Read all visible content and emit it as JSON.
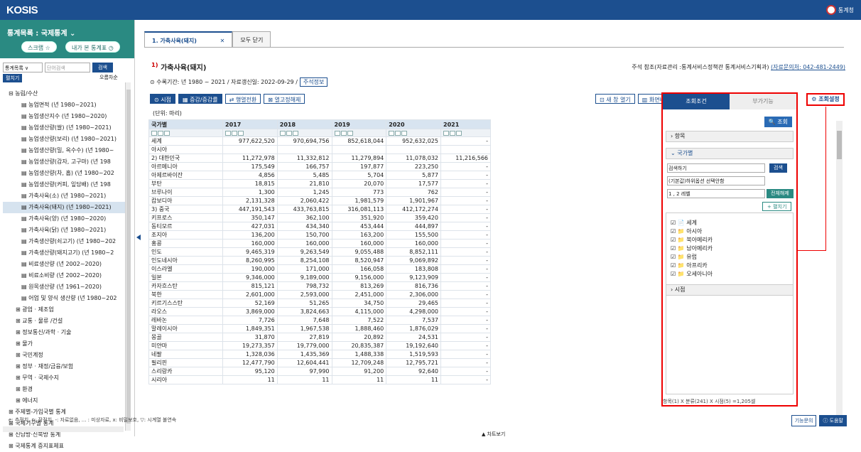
{
  "app": {
    "logo": "KOSIS",
    "agency": "통계청"
  },
  "sidebar": {
    "title": "통계목록 : 국제통계 ⌄",
    "btn1": "스크랩 ☆",
    "btn2": "내가 본 통계표 ◷",
    "select": "통계목록 ∨",
    "placeholder": "단어검색",
    "search": "검색",
    "menu": "펼치기",
    "sort": "오름차순",
    "tree": [
      {
        "t": "⊟ 농림/수산",
        "l": "lvl0"
      },
      {
        "t": "▤ 농업면적 (년 1980~2021)",
        "l": "lvl2"
      },
      {
        "t": "▤ 농업생산지수 (년 1980~2020)",
        "l": "lvl2"
      },
      {
        "t": "▤ 농업생산량(쌀) (년 1980~2021)",
        "l": "lvl2"
      },
      {
        "t": "▤ 농업생산량(보리) (년 1980~2021)",
        "l": "lvl2"
      },
      {
        "t": "▤ 농업생산량(밀, 옥수수) (년 1980~",
        "l": "lvl2"
      },
      {
        "t": "▤ 농업생산량(감자, 고구마) (년 198",
        "l": "lvl2"
      },
      {
        "t": "▤ 농업생산량(차, 홉) (년 1980~202",
        "l": "lvl2"
      },
      {
        "t": "▤ 농업생산량(커피, 잎담배) (년 198",
        "l": "lvl2"
      },
      {
        "t": "▤ 가축사육(소) (년 1980~2021)",
        "l": "lvl2"
      },
      {
        "t": "▤ 가축사육(돼지) (년 1980~2021)",
        "l": "lvl2 sel-item"
      },
      {
        "t": "▤ 가축사육(양) (년 1980~2020)",
        "l": "lvl2"
      },
      {
        "t": "▤ 가축사육(닭) (년 1980~2021)",
        "l": "lvl2"
      },
      {
        "t": "▤ 가축생산량(쇠고기) (년 1980~202",
        "l": "lvl2"
      },
      {
        "t": "▤ 가축생산량(돼지고기) (년 1980~2",
        "l": "lvl2"
      },
      {
        "t": "▤ 비료생산량 (년 2002~2020)",
        "l": "lvl2"
      },
      {
        "t": "▤ 비료소비량 (년 2002~2020)",
        "l": "lvl2"
      },
      {
        "t": "▤ 원목생산량 (년 1961~2020)",
        "l": "lvl2"
      },
      {
        "t": "▤ 어업 및 양식 생산량 (년 1980~202",
        "l": "lvl2"
      },
      {
        "t": "⊞ 광업 · 제조업",
        "l": "lvl1"
      },
      {
        "t": "⊞ 교통 · 물류 /건설",
        "l": "lvl1"
      },
      {
        "t": "⊞ 정보통신/과학 · 기술",
        "l": "lvl1"
      },
      {
        "t": "⊞ 물가",
        "l": "lvl1"
      },
      {
        "t": "⊞ 국민계정",
        "l": "lvl1"
      },
      {
        "t": "⊞ 정부 · 재정/금융/보험",
        "l": "lvl1"
      },
      {
        "t": "⊞ 무역 · 국제수지",
        "l": "lvl1"
      },
      {
        "t": "⊞ 환경",
        "l": "lvl1"
      },
      {
        "t": "⊞ 에너지",
        "l": "lvl1"
      },
      {
        "t": "⊞ 주제별-가입국별 통계",
        "l": "lvl0"
      },
      {
        "t": "⊞ 국제기구별 통계",
        "l": "lvl0"
      },
      {
        "t": "⊞ 신남방·신북방 통계",
        "l": "lvl0"
      },
      {
        "t": "⊞ 국제통계 증지표체표",
        "l": "lvl0"
      }
    ]
  },
  "tabs": {
    "active": "1. 가축사육(돼지)",
    "close": "✕",
    "closeall": "모두 닫기"
  },
  "table": {
    "title": "가축사육(돼지)",
    "sup": "1)",
    "notice": "주석 참조(자료관리 :통계서비스정책관 통계서비스기획과)",
    "contact": "(자료문의처: 042-481-2449)",
    "info": "⊙ 수록기간: 년 1980 ~ 2021 / 자료갱신일: 2022-09-29 /",
    "infobtn": "주석정보",
    "tb": [
      "⊙ 시점",
      "▦ 증감/증감률",
      "⇄ 행열전환",
      "⊠ 열고정해제"
    ],
    "tbr": [
      "⊡ 새 창 열기",
      "▥ 화면비"
    ],
    "unit": "(단위: 마리)",
    "headers": [
      "국가별",
      "2017",
      "2018",
      "2019",
      "2020",
      "2021"
    ],
    "rows": [
      [
        "세계",
        "977,622,520",
        "970,694,756",
        "852,618,044",
        "952,632,025",
        "-"
      ],
      [
        "아시아",
        "",
        "",
        "",
        "",
        ""
      ],
      [
        "2) 대한민국",
        "11,272,978",
        "11,332,812",
        "11,279,894",
        "11,078,032",
        "11,216,566"
      ],
      [
        "아르메니아",
        "175,549",
        "166,757",
        "197,877",
        "223,250",
        "-"
      ],
      [
        "아제르바이잔",
        "4,856",
        "5,485",
        "5,704",
        "5,877",
        "-"
      ],
      [
        "부탄",
        "18,815",
        "21,810",
        "20,070",
        "17,577",
        "-"
      ],
      [
        "브루나이",
        "1,300",
        "1,245",
        "773",
        "762",
        "-"
      ],
      [
        "캄보디아",
        "2,131,328",
        "2,060,422",
        "1,981,579",
        "1,901,967",
        "-"
      ],
      [
        "3) 중국",
        "447,191,543",
        "433,763,815",
        "316,081,113",
        "412,172,274",
        "-"
      ],
      [
        "키프로스",
        "350,147",
        "362,100",
        "351,920",
        "359,420",
        "-"
      ],
      [
        "동티모르",
        "427,031",
        "434,340",
        "453,444",
        "444,897",
        "-"
      ],
      [
        "조지아",
        "136,200",
        "150,700",
        "163,200",
        "155,500",
        "-"
      ],
      [
        "홍콩",
        "160,000",
        "160,000",
        "160,000",
        "160,000",
        "-"
      ],
      [
        "인도",
        "9,465,319",
        "9,263,549",
        "9,055,488",
        "8,852,111",
        "-"
      ],
      [
        "인도네시아",
        "8,260,995",
        "8,254,108",
        "8,520,947",
        "9,069,892",
        "-"
      ],
      [
        "이스라엘",
        "190,000",
        "171,000",
        "166,058",
        "183,808",
        "-"
      ],
      [
        "일본",
        "9,346,000",
        "9,189,000",
        "9,156,000",
        "9,123,909",
        "-"
      ],
      [
        "카자흐스탄",
        "815,121",
        "798,732",
        "813,269",
        "816,736",
        "-"
      ],
      [
        "북한",
        "2,601,000",
        "2,593,000",
        "2,451,000",
        "2,306,000",
        "-"
      ],
      [
        "키르기스스탄",
        "52,169",
        "51,265",
        "34,750",
        "29,465",
        "-"
      ],
      [
        "라오스",
        "3,869,000",
        "3,824,663",
        "4,115,000",
        "4,298,000",
        "-"
      ],
      [
        "레바논",
        "7,726",
        "7,648",
        "7,522",
        "7,537",
        "-"
      ],
      [
        "말레이시아",
        "1,849,351",
        "1,967,538",
        "1,888,460",
        "1,876,029",
        "-"
      ],
      [
        "몽골",
        "31,870",
        "27,819",
        "20,892",
        "24,531",
        "-"
      ],
      [
        "미얀마",
        "19,273,357",
        "19,779,000",
        "20,835,387",
        "19,192,640",
        "-"
      ],
      [
        "네팔",
        "1,328,036",
        "1,435,369",
        "1,488,338",
        "1,519,593",
        "-"
      ],
      [
        "필리핀",
        "12,477,790",
        "12,604,441",
        "12,709,248",
        "12,795,721",
        "-"
      ],
      [
        "스리랑카",
        "95,120",
        "97,990",
        "91,200",
        "92,640",
        "-"
      ],
      [
        "시리아",
        "11",
        "11",
        "11",
        "11",
        "-"
      ]
    ]
  },
  "panel": {
    "tab1": "조회조건",
    "tab2": "부가기능",
    "query": "🔍 조회",
    "items": "› 항목",
    "country": "⌄ 국가별",
    "search_ph": "검색하기",
    "search": "검색",
    "opt1": "(기본값)하위옵션 선택안함",
    "opt2": "1 , 2 레벨",
    "clear": "전체해제",
    "expand": "+ 펼치기",
    "list": [
      "☑ 📄 세계",
      "☑ 📁 아시아",
      "☑ 📁 북아메리카",
      "☑ 📁 남아메리카",
      "☑ 📁 유럽",
      "☑ 📁 아프리카",
      "☑ 📁 오세아니아"
    ],
    "period": "› 시점",
    "foot": "항목(1) X 분류(241) X 시점(5) =1,205셀"
  },
  "settings": "⚙ 조회설정",
  "legend": "e: 추정치, p: 잠정치, -: 자료없음, ... : 미상자료, x: 비밀보호, ▽: 시계열 불연속",
  "help": {
    "inquiry": "기능문의",
    "help": "ⓘ 도움말"
  },
  "chart": "▲ 차트보기"
}
